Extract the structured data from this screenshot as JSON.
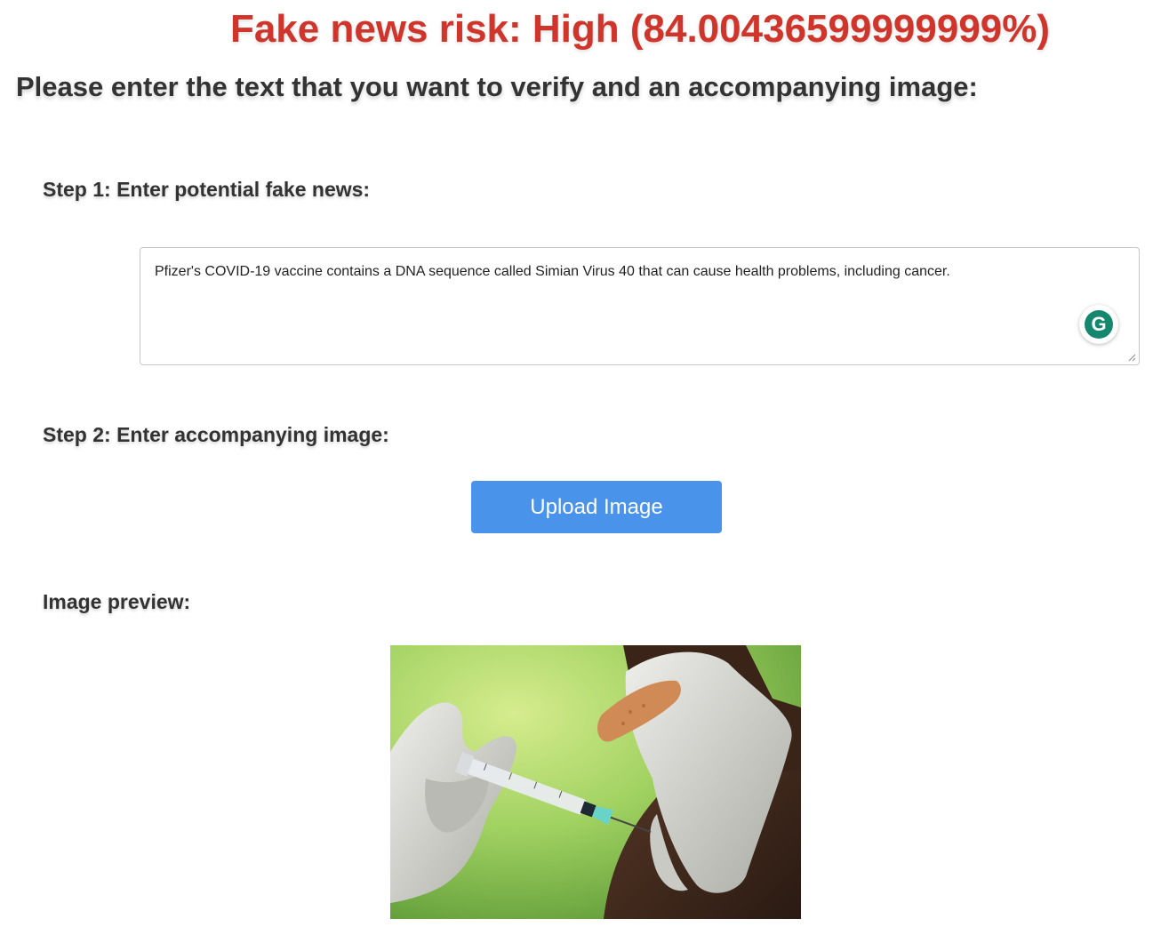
{
  "result": {
    "risk_text": "Fake news risk: High (84.00436599999999%)",
    "risk_color": "#d0352b"
  },
  "intro": {
    "heading": "Please enter the text that you want to verify and an accompanying image:"
  },
  "step1": {
    "label": "Step 1: Enter potential fake news:",
    "text_value": "Pfizer's COVID-19 vaccine contains a DNA sequence called Simian Virus 40 that can cause health problems, including cancer.",
    "assistant_icon": "grammarly-icon",
    "assistant_glyph": "G"
  },
  "step2": {
    "label": "Step 2: Enter accompanying image:",
    "upload_button_label": "Upload Image",
    "button_color": "#4a93ea"
  },
  "preview": {
    "label": "Image preview:",
    "image_subject": "gloved hands injecting a vaccine syringe into a person's arm with a bandage"
  }
}
